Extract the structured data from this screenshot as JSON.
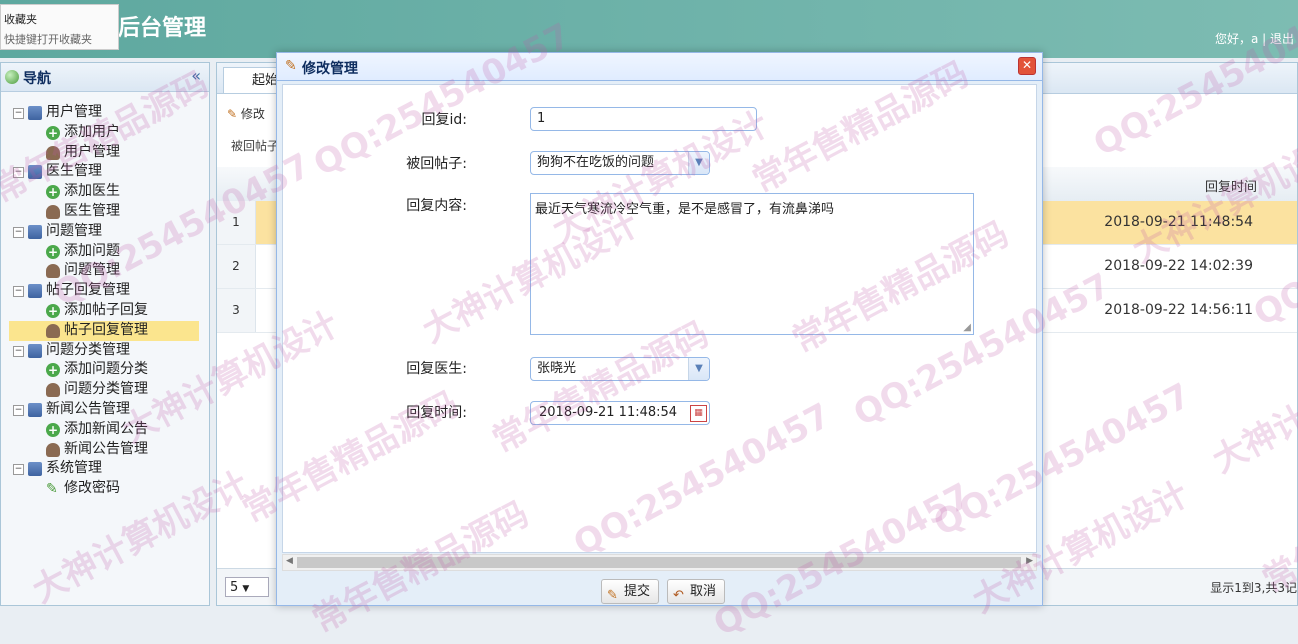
{
  "header": {
    "title": "后台管理",
    "user_text": "您好，a | 退出"
  },
  "favorites_popup": {
    "title": "收藏夹",
    "hint": "快捷键打开收藏夹"
  },
  "nav": {
    "title": "导航",
    "collapse_glyph": "«",
    "items": [
      {
        "label": "用户管理",
        "type": "group"
      },
      {
        "label": "添加用户",
        "type": "add"
      },
      {
        "label": "用户管理",
        "type": "user"
      },
      {
        "label": "医生管理",
        "type": "group"
      },
      {
        "label": "添加医生",
        "type": "add"
      },
      {
        "label": "医生管理",
        "type": "user"
      },
      {
        "label": "问题管理",
        "type": "group"
      },
      {
        "label": "添加问题",
        "type": "add"
      },
      {
        "label": "问题管理",
        "type": "user"
      },
      {
        "label": "帖子回复管理",
        "type": "group"
      },
      {
        "label": "添加帖子回复",
        "type": "add"
      },
      {
        "label": "帖子回复管理",
        "type": "user",
        "selected": true
      },
      {
        "label": "问题分类管理",
        "type": "group"
      },
      {
        "label": "添加问题分类",
        "type": "add"
      },
      {
        "label": "问题分类管理",
        "type": "user"
      },
      {
        "label": "新闻公告管理",
        "type": "group"
      },
      {
        "label": "添加新闻公告",
        "type": "add"
      },
      {
        "label": "新闻公告管理",
        "type": "user"
      },
      {
        "label": "系统管理",
        "type": "group"
      },
      {
        "label": "修改密码",
        "type": "pen"
      }
    ]
  },
  "main": {
    "home_tab": "起始",
    "toolbar_edit": "修改",
    "crumb": "被回帖子",
    "column_header": "回复时间",
    "rows": [
      {
        "num": "1",
        "time": "2018-09-21 11:48:54"
      },
      {
        "num": "2",
        "time": "2018-09-22 14:02:39"
      },
      {
        "num": "3",
        "time": "2018-09-22 14:56:11"
      }
    ],
    "page_size": "5",
    "pager_info": "显示1到3,共3记"
  },
  "dialog": {
    "title": "修改管理",
    "fields": {
      "id_label": "回复id:",
      "id_value": "1",
      "post_label": "被回帖子:",
      "post_value": "狗狗不在吃饭的问题",
      "content_label": "回复内容:",
      "content_value": "最近天气寒流冷空气重，是不是感冒了，有流鼻涕吗",
      "doctor_label": "回复医生:",
      "doctor_value": "张晓光",
      "time_label": "回复时间:",
      "time_value": "2018-09-21 11:48:54"
    },
    "submit_label": "提交",
    "cancel_label": "取消"
  },
  "watermarks": [
    "QQ:254540457",
    "大神计算机设计",
    "常年售精品源码",
    "QQ:254540457",
    "大神计算机设计",
    "常年售精品源码",
    "QQ:254540457",
    "大神计算机设计",
    "常年售精品源码",
    "QQ:254540457",
    "大神计算机设计",
    "常年售精品源码",
    "QQ:254540457",
    "大神计算机设计",
    "常年售精品源码",
    "QQ:254540457"
  ]
}
